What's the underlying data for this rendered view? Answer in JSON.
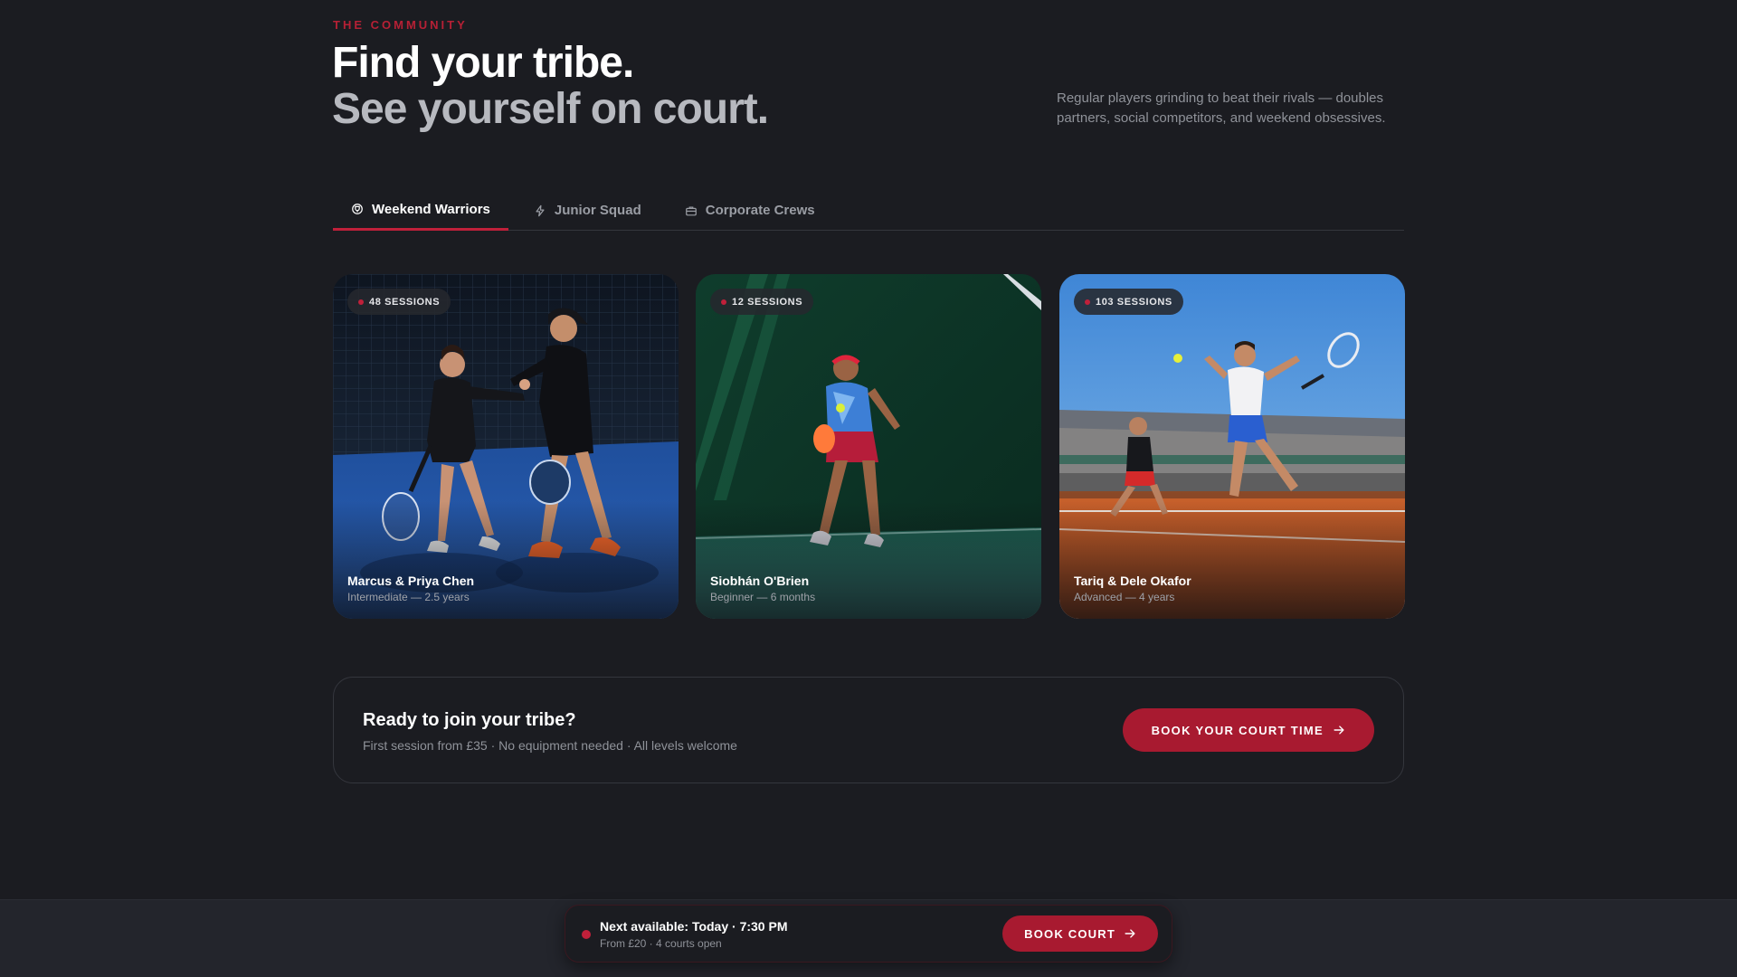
{
  "section": {
    "eyebrow": "THE COMMUNITY",
    "headline_line1": "Find your tribe.",
    "headline_line2": "See yourself on court.",
    "intro": "Regular players grinding to beat their rivals — doubles partners, social competitors, and weekend obsessives."
  },
  "tabs": [
    {
      "label": "Weekend Warriors",
      "icon": "trophy-icon",
      "active": true
    },
    {
      "label": "Junior Squad",
      "icon": "lightning-icon",
      "active": false
    },
    {
      "label": "Corporate Crews",
      "icon": "briefcase-icon",
      "active": false
    }
  ],
  "cards": [
    {
      "badge": "48 SESSIONS",
      "name": "Marcus & Priya Chen",
      "detail": "Intermediate — 2.5 years"
    },
    {
      "badge": "12 SESSIONS",
      "name": "Siobhán O'Brien",
      "detail": "Beginner — 6 months"
    },
    {
      "badge": "103 SESSIONS",
      "name": "Tariq & Dele Okafor",
      "detail": "Advanced — 4 years"
    }
  ],
  "cta": {
    "title": "Ready to join your tribe?",
    "subtitle": "First session from £35 · No equipment needed · All levels welcome",
    "button": "BOOK YOUR COURT TIME"
  },
  "availability": {
    "headline": "Next available: Today · 7:30 PM",
    "detail": "From £20 · 4 courts open",
    "button": "BOOK COURT"
  },
  "colors": {
    "background": "#1b1c21",
    "accent": "#a81a30",
    "eyebrow": "#b62035",
    "muted_text": "#8f9299"
  }
}
